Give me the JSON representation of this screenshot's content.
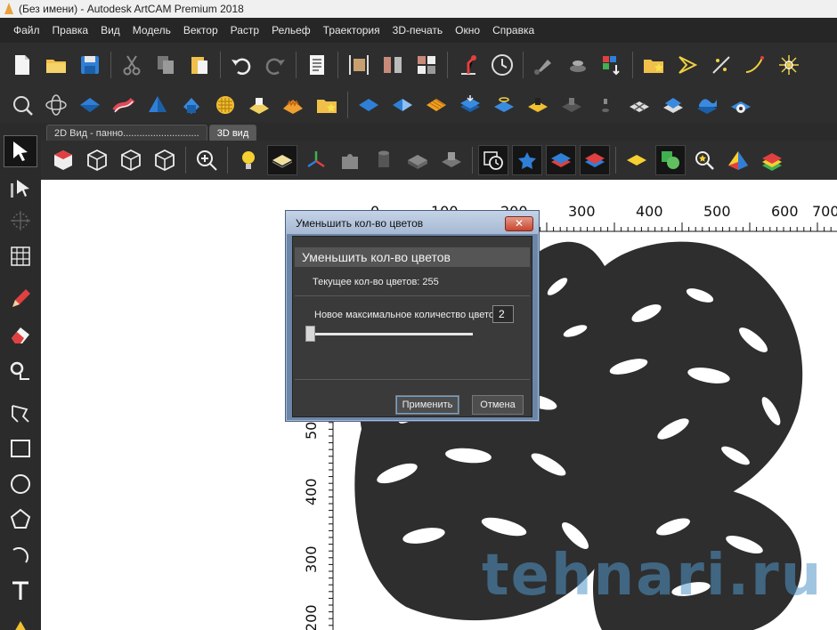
{
  "window": {
    "title": "(Без имени) - Autodesk ArtCAM Premium 2018"
  },
  "menu": [
    "Файл",
    "Правка",
    "Вид",
    "Модель",
    "Вектор",
    "Растр",
    "Рельеф",
    "Траектория",
    "3D-печать",
    "Окно",
    "Справка"
  ],
  "tabs": [
    {
      "label": "2D Вид - панно............................",
      "active": false
    },
    {
      "label": "3D вид",
      "active": true
    }
  ],
  "ruler": {
    "top": [
      "0",
      "100",
      "200",
      "300",
      "400",
      "500",
      "600",
      "700"
    ],
    "left": [
      "500",
      "400",
      "300",
      "200"
    ]
  },
  "dialog": {
    "title": "Уменьшить кол-во цветов",
    "close": "✕",
    "heading": "Уменьшить кол-во цветов",
    "current_label": "Текущее кол-во цветов: 255",
    "new_label": "Новое максимальное количество цветов",
    "new_value": "2",
    "slider_fraction": 0,
    "apply": "Применить",
    "cancel": "Отмена"
  },
  "watermark": "tehnari.ru",
  "colors": {
    "accent_blue": "#2f7fd6",
    "leaf": "#2e2e2e",
    "dialog_frame": "#6c86a8"
  },
  "icons": {
    "toolbar1": [
      "new-file-icon",
      "open-folder-icon",
      "save-icon",
      "cut-icon",
      "copy-icon",
      "paste-icon",
      "undo-icon",
      "redo-icon",
      "notes-icon",
      "resize-icon",
      "split-icon",
      "grid-icon",
      "lamp-icon",
      "clock-icon",
      "paint-icon",
      "stack-icon",
      "color-sort-icon",
      "folder-star-icon",
      "vector-arrow-icon",
      "sparkle-icon",
      "curve-icon",
      "star-burst-icon"
    ],
    "toolbar2": [
      "zoom-fit-icon",
      "atom-icon",
      "relief-blue-icon",
      "relief-red-icon",
      "relief-blue-2-icon",
      "relief-blue-3-icon",
      "weave-icon",
      "relief-yellow-icon",
      "relief-orange-icon",
      "folder-star-icon",
      "relief-flat-icon",
      "relief-split-icon",
      "relief-stripes-icon",
      "relief-stack-icon",
      "relief-arrows-icon",
      "relief-gold-icon",
      "relief-dark-icon",
      "relief-small-icon",
      "relief-cross-icon",
      "relief-layers-icon",
      "relief-wave-icon",
      "relief-rotate-icon"
    ],
    "toolbar3": [
      "cube-solid-icon",
      "cube-front-icon",
      "cube-side-icon",
      "cube-top-icon",
      "zoom-in-icon",
      "light-bulb-icon",
      "plane-icon",
      "axes-icon",
      "puzzle-icon",
      "cylinder-icon",
      "box-icon",
      "scan-icon",
      "clock-icon",
      "star-blue-icon",
      "layers-blue-icon",
      "layers-red-icon",
      "plane-yellow-icon",
      "shapes-green-icon",
      "zoom-star-icon",
      "pyramid-icon",
      "stairs-icon"
    ],
    "leftbar": [
      "select-arrow-icon",
      "node-edit-icon",
      "transform-icon",
      "mesh-icon",
      "pencil-icon",
      "eraser-icon",
      "measure-icon",
      "polyline-icon",
      "rectangle-icon",
      "circle-icon",
      "polygon-icon",
      "arc-icon",
      "text-icon",
      "warning-icon"
    ]
  }
}
